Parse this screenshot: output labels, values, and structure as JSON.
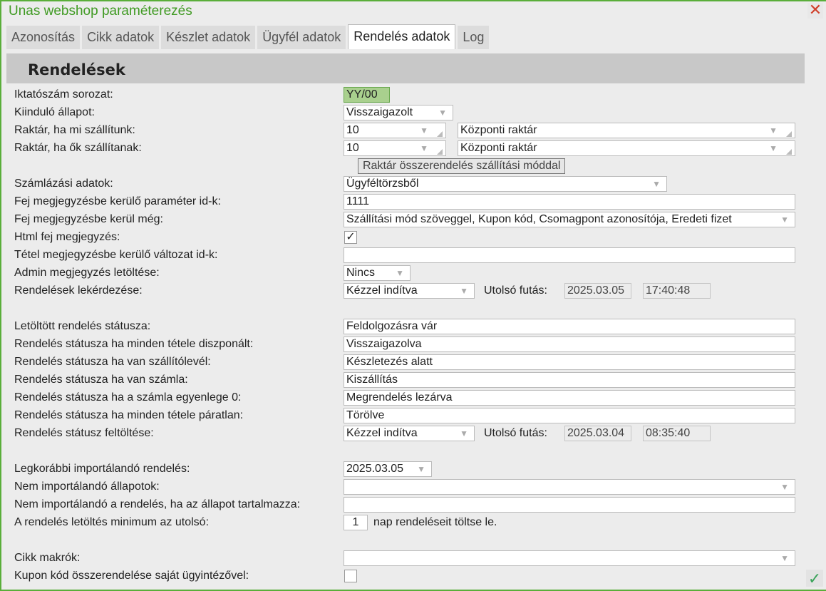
{
  "window": {
    "title": "Unas webshop paraméterezés",
    "close_icon": "close-icon",
    "ok_icon": "check-icon"
  },
  "tabs": [
    "Azonosítás",
    "Cikk adatok",
    "Készlet adatok",
    "Ügyfél adatok",
    "Rendelés adatok",
    "Log"
  ],
  "active_tab": "Rendelés adatok",
  "section_title": "Rendelések",
  "labels": {
    "iktato": "Iktatószám sorozat:",
    "kiindulo": "Kiinduló állapot:",
    "raktar_mi": "Raktár, ha mi szállítunk:",
    "raktar_ok": "Raktár, ha ők szállítanak:",
    "szamlazasi": "Számlázási adatok:",
    "fej_param": "Fej megjegyzésbe kerülő paraméter id-k:",
    "fej_meg": "Fej megjegyzésbe kerül még:",
    "html_fej": "Html fej megjegyzés:",
    "tetel": "Tétel megjegyzésbe kerülő változat id-k:",
    "admin": "Admin megjegyzés letöltése:",
    "lekerdezes": "Rendelések lekérdezése:",
    "letoltott": "Letöltött rendelés státusza:",
    "diszponalt": "Rendelés státusza ha minden tétele diszponált:",
    "szallitolevel": "Rendelés státusza ha van szállítólevél:",
    "szamla": "Rendelés státusza ha van számla:",
    "egyenleg": "Rendelés státusza ha a számla egyenlege 0:",
    "paratlan": "Rendelés státusza ha minden tétele páratlan:",
    "feltoltes": "Rendelés státusz feltöltése:",
    "legkorabbi": "Legkorábbi importálandó rendelés:",
    "nem_allapot": "Nem importálandó állapotok:",
    "nem_tartalmaz": "Nem importálandó a rendelés, ha az állapot tartalmazza:",
    "minimum": "A rendelés letöltés minimum az utolsó:",
    "cikk_makrok": "Cikk makrók:",
    "kupon": "Kupon kód összerendelése saját ügyintézővel:",
    "utolso_futas": "Utolsó futás:",
    "nap_suffix": "nap rendeléseit töltse le."
  },
  "values": {
    "iktato": "YY/00",
    "kiindulo": "Visszaigazolt",
    "raktar_mi_kod": "10",
    "raktar_mi_nev": "Központi raktár",
    "raktar_ok_kod": "10",
    "raktar_ok_nev": "Központi raktár",
    "raktar_button": "Raktár összerendelés szállítási móddal",
    "szamlazasi": "Ügyféltörzsből",
    "fej_param": "1111",
    "fej_meg": "Szállítási mód szöveggel, Kupon kód, Csomagpont azonosítója, Eredeti fizet",
    "html_fej": "✓",
    "tetel": "",
    "admin": "Nincs",
    "lekerdezes": "Kézzel indítva",
    "lekerdezes_datum": "2025.03.05",
    "lekerdezes_ido": "17:40:48",
    "letoltott": "Feldolgozásra vár",
    "diszponalt": "Visszaigazolva",
    "szallitolevel": "Készletezés alatt",
    "szamla": "Kiszállítás",
    "egyenleg": "Megrendelés lezárva",
    "paratlan": "Törölve",
    "feltoltes": "Kézzel indítva",
    "feltoltes_datum": "2025.03.04",
    "feltoltes_ido": "08:35:40",
    "legkorabbi": "2025.03.05",
    "nem_allapot": "",
    "nem_tartalmaz": "",
    "minimum": "1",
    "cikk_makrok": "",
    "kupon": ""
  }
}
